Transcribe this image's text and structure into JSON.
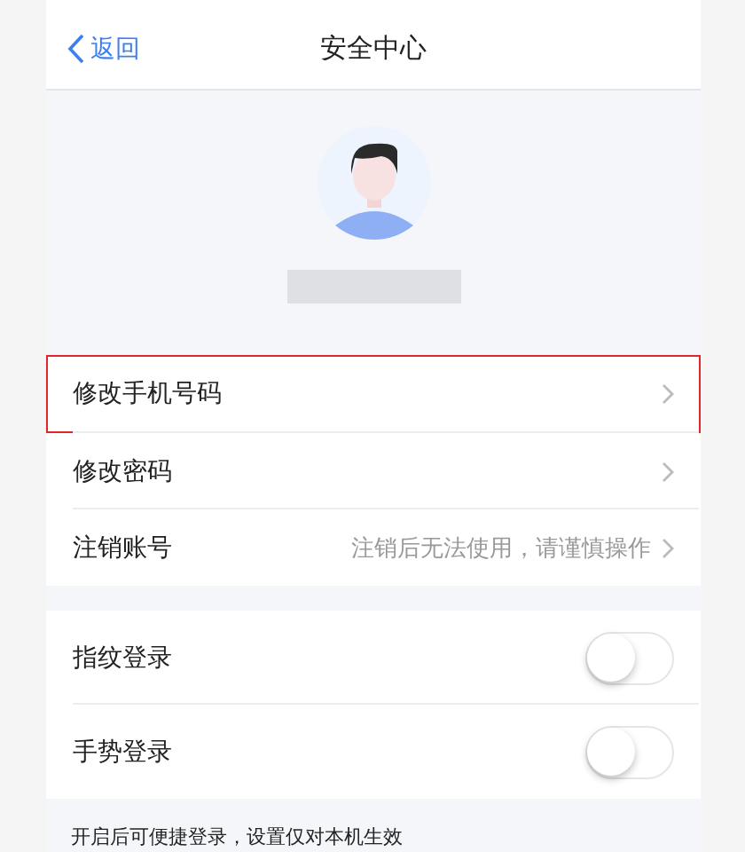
{
  "nav_bar": {
    "back": "返回",
    "title": "安全中心"
  },
  "profile": {
    "name_redacted": true
  },
  "account_rows": [
    {
      "label": "修改手机号码",
      "highlighted": true
    },
    {
      "label": "修改密码",
      "highlighted": false
    },
    {
      "label": "注销账号",
      "value": "注销后无法使用，请谨慎操作",
      "highlighted": false
    }
  ],
  "login_toggles": [
    {
      "label": "指纹登录",
      "on": false
    },
    {
      "label": "手势登录",
      "on": false
    }
  ],
  "footer_note": "开启后可便捷登录，设置仅对本机生效"
}
